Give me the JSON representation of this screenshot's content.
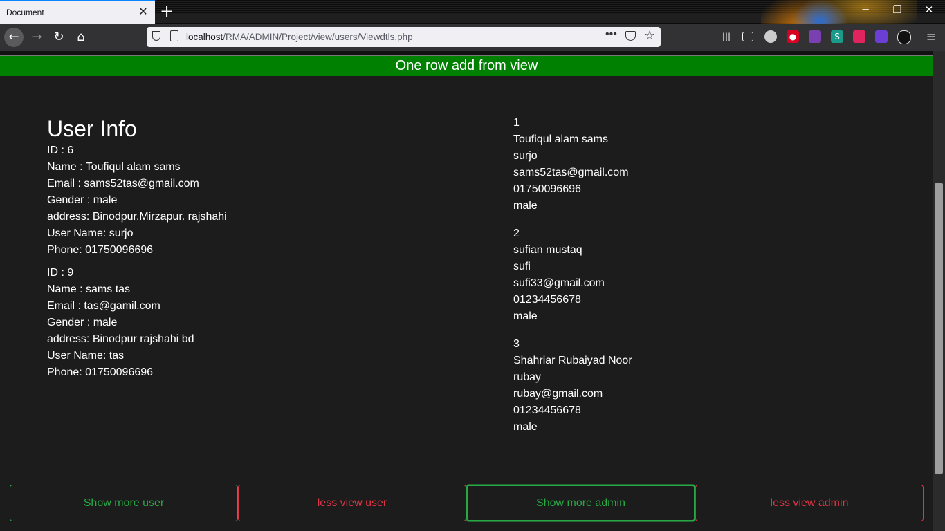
{
  "browser": {
    "tab_title": "Document",
    "tab_close": "✕",
    "new_tab": "+",
    "url_host": "localhost",
    "url_path": "/RMA/ADMIN/Project/view/users/Viewdtls.php",
    "url_dots": "•••"
  },
  "banner": {
    "text": "One row add from view"
  },
  "user_info": {
    "heading": "User Info",
    "records": [
      {
        "id": "ID : 6",
        "name": "Name : Toufiqul alam sams",
        "email": "Email : sams52tas@gmail.com",
        "gender": "Gender : male",
        "address": "address: Binodpur,Mirzapur. rajshahi",
        "username": "User Name: surjo",
        "phone": "Phone: 01750096696"
      },
      {
        "id": "ID : 9",
        "name": "Name : sams tas",
        "email": "Email : tas@gamil.com",
        "gender": "Gender : male",
        "address": "address: Binodpur rajshahi bd",
        "username": "User Name: tas",
        "phone": "Phone: 01750096696"
      }
    ]
  },
  "admin_list": [
    {
      "num": "1",
      "name": "Toufiqul alam sams",
      "username": "surjo",
      "email": "sams52tas@gmail.com",
      "phone": "01750096696",
      "gender": "male"
    },
    {
      "num": "2",
      "name": "sufian mustaq",
      "username": "sufi",
      "email": "sufi33@gmail.com",
      "phone": "01234456678",
      "gender": "male"
    },
    {
      "num": "3",
      "name": "Shahriar Rubaiyad Noor",
      "username": "rubay",
      "email": "rubay@gmail.com",
      "phone": "01234456678",
      "gender": "male"
    }
  ],
  "buttons": {
    "show_more_user": "Show more user",
    "less_view_user": "less view user",
    "show_more_admin": "Show more admin",
    "less_view_admin": "less view admin"
  },
  "colors": {
    "banner": "#008000",
    "success": "#28a745",
    "danger": "#dc3545",
    "background": "#1c1c1c"
  }
}
